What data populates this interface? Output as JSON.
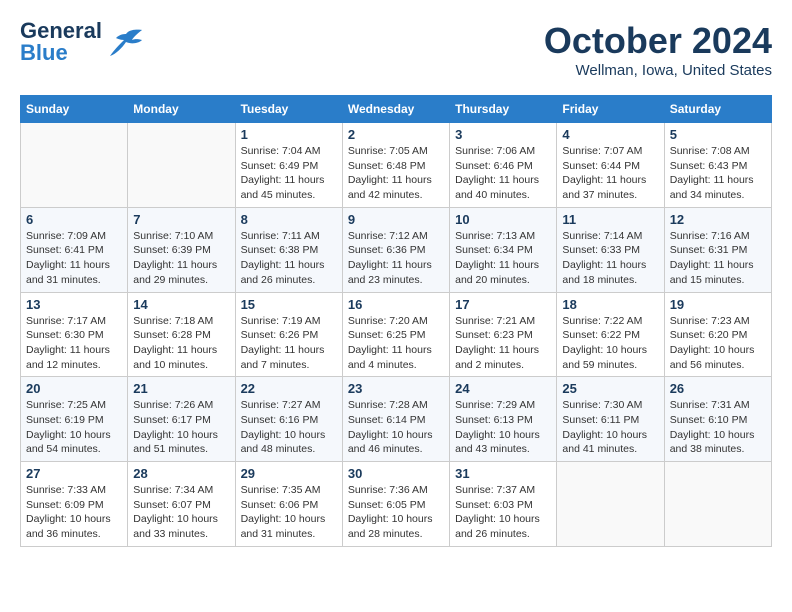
{
  "header": {
    "logo_line1": "General",
    "logo_line2": "Blue",
    "month_title": "October 2024",
    "location": "Wellman, Iowa, United States"
  },
  "columns": [
    "Sunday",
    "Monday",
    "Tuesday",
    "Wednesday",
    "Thursday",
    "Friday",
    "Saturday"
  ],
  "weeks": [
    [
      {
        "day": "",
        "info": ""
      },
      {
        "day": "",
        "info": ""
      },
      {
        "day": "1",
        "info": "Sunrise: 7:04 AM\nSunset: 6:49 PM\nDaylight: 11 hours and 45 minutes."
      },
      {
        "day": "2",
        "info": "Sunrise: 7:05 AM\nSunset: 6:48 PM\nDaylight: 11 hours and 42 minutes."
      },
      {
        "day": "3",
        "info": "Sunrise: 7:06 AM\nSunset: 6:46 PM\nDaylight: 11 hours and 40 minutes."
      },
      {
        "day": "4",
        "info": "Sunrise: 7:07 AM\nSunset: 6:44 PM\nDaylight: 11 hours and 37 minutes."
      },
      {
        "day": "5",
        "info": "Sunrise: 7:08 AM\nSunset: 6:43 PM\nDaylight: 11 hours and 34 minutes."
      }
    ],
    [
      {
        "day": "6",
        "info": "Sunrise: 7:09 AM\nSunset: 6:41 PM\nDaylight: 11 hours and 31 minutes."
      },
      {
        "day": "7",
        "info": "Sunrise: 7:10 AM\nSunset: 6:39 PM\nDaylight: 11 hours and 29 minutes."
      },
      {
        "day": "8",
        "info": "Sunrise: 7:11 AM\nSunset: 6:38 PM\nDaylight: 11 hours and 26 minutes."
      },
      {
        "day": "9",
        "info": "Sunrise: 7:12 AM\nSunset: 6:36 PM\nDaylight: 11 hours and 23 minutes."
      },
      {
        "day": "10",
        "info": "Sunrise: 7:13 AM\nSunset: 6:34 PM\nDaylight: 11 hours and 20 minutes."
      },
      {
        "day": "11",
        "info": "Sunrise: 7:14 AM\nSunset: 6:33 PM\nDaylight: 11 hours and 18 minutes."
      },
      {
        "day": "12",
        "info": "Sunrise: 7:16 AM\nSunset: 6:31 PM\nDaylight: 11 hours and 15 minutes."
      }
    ],
    [
      {
        "day": "13",
        "info": "Sunrise: 7:17 AM\nSunset: 6:30 PM\nDaylight: 11 hours and 12 minutes."
      },
      {
        "day": "14",
        "info": "Sunrise: 7:18 AM\nSunset: 6:28 PM\nDaylight: 11 hours and 10 minutes."
      },
      {
        "day": "15",
        "info": "Sunrise: 7:19 AM\nSunset: 6:26 PM\nDaylight: 11 hours and 7 minutes."
      },
      {
        "day": "16",
        "info": "Sunrise: 7:20 AM\nSunset: 6:25 PM\nDaylight: 11 hours and 4 minutes."
      },
      {
        "day": "17",
        "info": "Sunrise: 7:21 AM\nSunset: 6:23 PM\nDaylight: 11 hours and 2 minutes."
      },
      {
        "day": "18",
        "info": "Sunrise: 7:22 AM\nSunset: 6:22 PM\nDaylight: 10 hours and 59 minutes."
      },
      {
        "day": "19",
        "info": "Sunrise: 7:23 AM\nSunset: 6:20 PM\nDaylight: 10 hours and 56 minutes."
      }
    ],
    [
      {
        "day": "20",
        "info": "Sunrise: 7:25 AM\nSunset: 6:19 PM\nDaylight: 10 hours and 54 minutes."
      },
      {
        "day": "21",
        "info": "Sunrise: 7:26 AM\nSunset: 6:17 PM\nDaylight: 10 hours and 51 minutes."
      },
      {
        "day": "22",
        "info": "Sunrise: 7:27 AM\nSunset: 6:16 PM\nDaylight: 10 hours and 48 minutes."
      },
      {
        "day": "23",
        "info": "Sunrise: 7:28 AM\nSunset: 6:14 PM\nDaylight: 10 hours and 46 minutes."
      },
      {
        "day": "24",
        "info": "Sunrise: 7:29 AM\nSunset: 6:13 PM\nDaylight: 10 hours and 43 minutes."
      },
      {
        "day": "25",
        "info": "Sunrise: 7:30 AM\nSunset: 6:11 PM\nDaylight: 10 hours and 41 minutes."
      },
      {
        "day": "26",
        "info": "Sunrise: 7:31 AM\nSunset: 6:10 PM\nDaylight: 10 hours and 38 minutes."
      }
    ],
    [
      {
        "day": "27",
        "info": "Sunrise: 7:33 AM\nSunset: 6:09 PM\nDaylight: 10 hours and 36 minutes."
      },
      {
        "day": "28",
        "info": "Sunrise: 7:34 AM\nSunset: 6:07 PM\nDaylight: 10 hours and 33 minutes."
      },
      {
        "day": "29",
        "info": "Sunrise: 7:35 AM\nSunset: 6:06 PM\nDaylight: 10 hours and 31 minutes."
      },
      {
        "day": "30",
        "info": "Sunrise: 7:36 AM\nSunset: 6:05 PM\nDaylight: 10 hours and 28 minutes."
      },
      {
        "day": "31",
        "info": "Sunrise: 7:37 AM\nSunset: 6:03 PM\nDaylight: 10 hours and 26 minutes."
      },
      {
        "day": "",
        "info": ""
      },
      {
        "day": "",
        "info": ""
      }
    ]
  ]
}
